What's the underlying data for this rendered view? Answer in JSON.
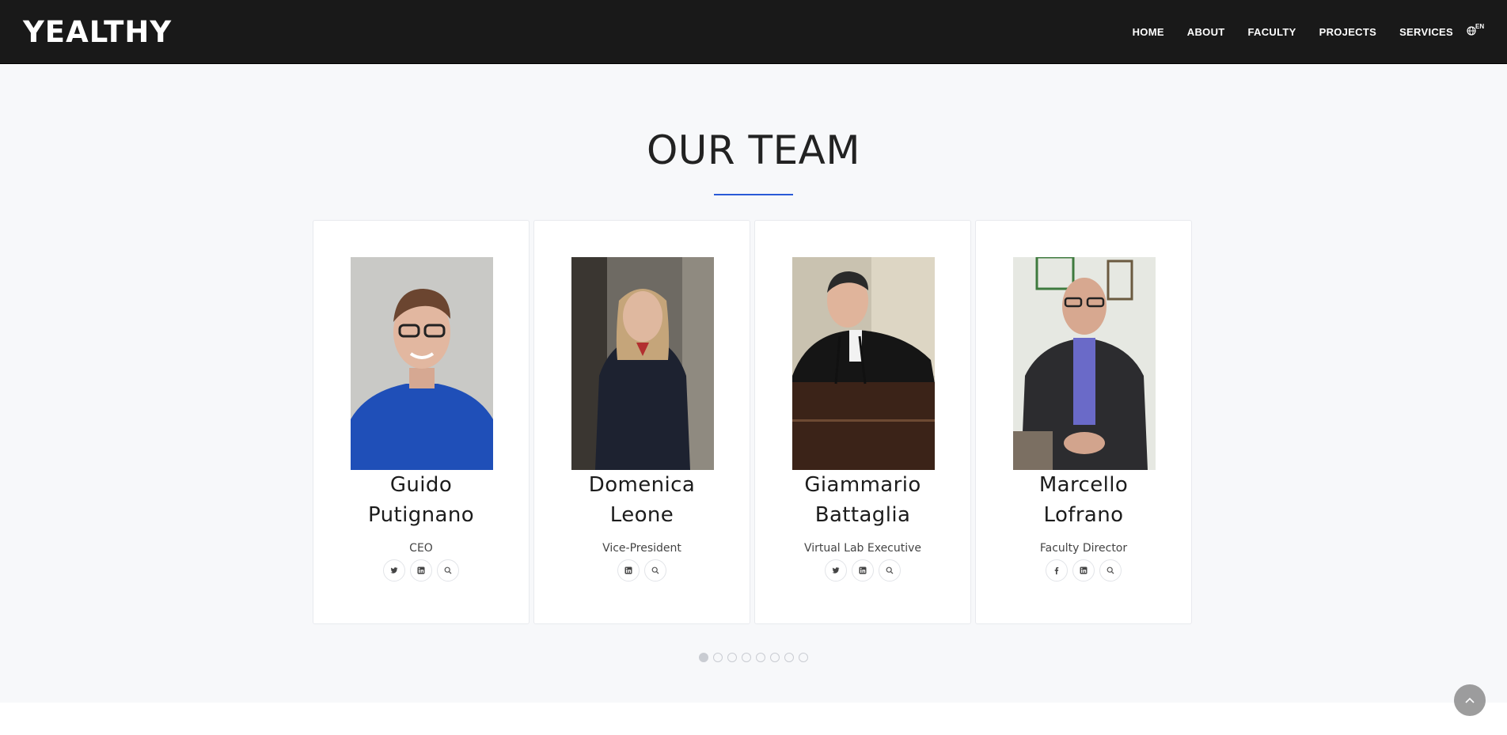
{
  "header": {
    "logo": "YEALTHY",
    "nav": [
      "HOME",
      "ABOUT",
      "FACULTY",
      "PROJECTS",
      "SERVICES"
    ],
    "lang": "EN"
  },
  "team": {
    "title": "OUR TEAM",
    "members": [
      {
        "name_line1": "Guido",
        "name_line2": "Putignano",
        "role": "CEO",
        "socials": [
          "twitter-icon",
          "linkedin-icon",
          "search-icon"
        ]
      },
      {
        "name_line1": "Domenica",
        "name_line2": "Leone",
        "role": "Vice-President",
        "socials": [
          "linkedin-icon",
          "search-icon"
        ]
      },
      {
        "name_line1": "Giammario",
        "name_line2": "Battaglia",
        "role": "Virtual Lab Executive",
        "socials": [
          "twitter-icon",
          "linkedin-icon",
          "search-icon"
        ]
      },
      {
        "name_line1": "Marcello",
        "name_line2": "Lofrano",
        "role": "Faculty Director",
        "socials": [
          "facebook-icon",
          "linkedin-icon",
          "search-icon"
        ]
      }
    ],
    "carousel_pages": 8,
    "carousel_active": 1
  },
  "colors": {
    "nav_bg": "#191919",
    "accent": "#2a5bd7",
    "page_bg": "#f7f8fa"
  }
}
